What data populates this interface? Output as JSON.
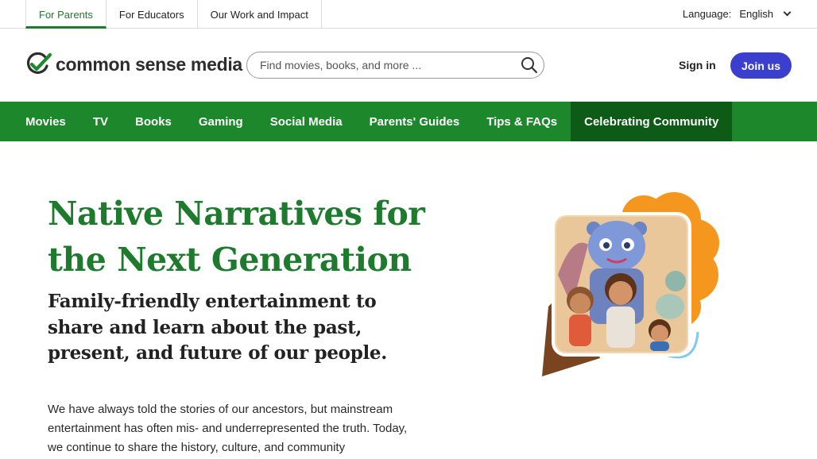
{
  "audience_tabs": [
    "For Parents",
    "For Educators",
    "Our Work and Impact"
  ],
  "language": {
    "label": "Language:",
    "value": "English"
  },
  "logo": {
    "text": "common sense media"
  },
  "search": {
    "placeholder": "Find movies, books, and more ..."
  },
  "auth": {
    "signin": "Sign in",
    "join": "Join us"
  },
  "nav": [
    "Movies",
    "TV",
    "Books",
    "Gaming",
    "Social Media",
    "Parents' Guides",
    "Tips & FAQs",
    "Celebrating Community"
  ],
  "hero": {
    "title": "Native Narratives for the Next Generation",
    "subtitle": "Family-friendly entertainment to share and learn about the past, present, and future of our people.",
    "body": "We have always told the stories of our ancestors, but mainstream entertainment has often mis- and underrepresented the truth. Today, we continue to share the history, culture, and community"
  },
  "colors": {
    "brand_green": "#1d872b",
    "active_nav": "#0e5a17",
    "join_button": "#3b3fce",
    "title_green": "#1e7a2c",
    "art_orange": "#f5961f"
  }
}
